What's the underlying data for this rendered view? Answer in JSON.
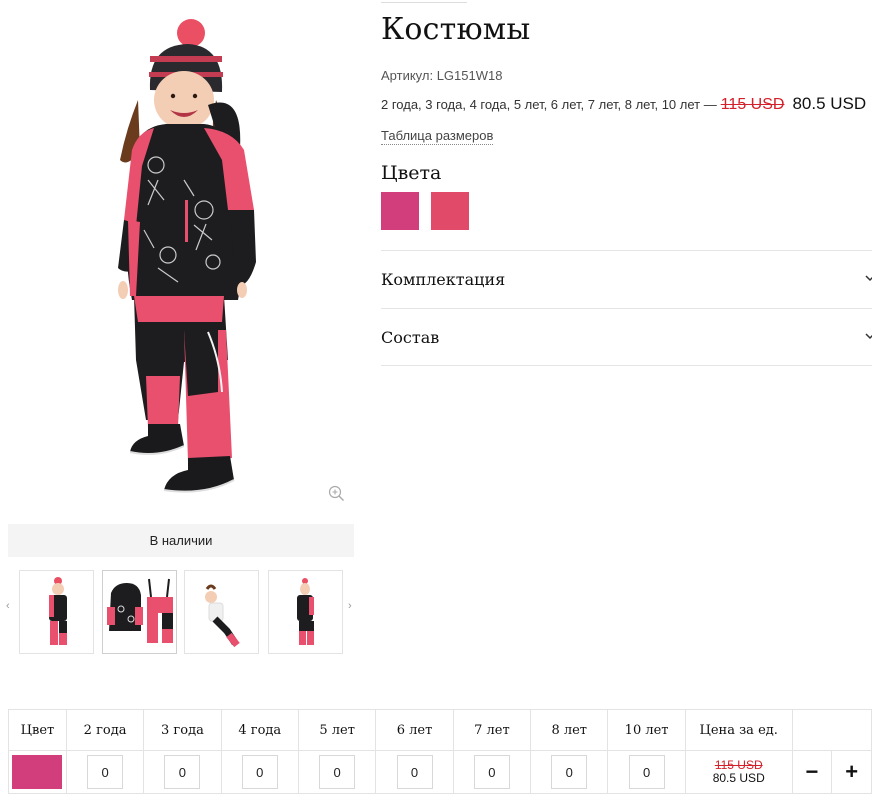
{
  "gallery": {
    "stock_label": "В наличии",
    "prev_arrow": "‹",
    "next_arrow": "›",
    "zoom_icon": "zoom-in-icon"
  },
  "product": {
    "title": "Костюмы",
    "sku": "Артикул: LG151W18",
    "sizes_text": "2 года, 3 года, 4 года, 5 лет, 6 лет, 7 лет, 8 лет, 10 лет —",
    "price_old": "115 USD",
    "price_new": "80.5 USD",
    "size_chart_link": "Таблица размеров",
    "colors_heading": "Цвета",
    "colors": [
      "#d23d7c",
      "#e14a68"
    ]
  },
  "accordions": [
    {
      "label": "Комплектация"
    },
    {
      "label": "Состав"
    }
  ],
  "order_table": {
    "headers": [
      "Цвет",
      "2 года",
      "3 года",
      "4 года",
      "5 лет",
      "6 лет",
      "7 лет",
      "8 лет",
      "10 лет",
      "Цена за ед."
    ],
    "row": {
      "color": "#d23d7c",
      "quantities": [
        "0",
        "0",
        "0",
        "0",
        "0",
        "0",
        "0",
        "0"
      ],
      "price_old": "115 USD",
      "price_new": "80.5 USD",
      "minus": "−",
      "plus": "+"
    }
  },
  "colors": {
    "accent_pink": "#e8506e",
    "strike_red": "#d4202a",
    "jacket_black": "#1d1d1f"
  }
}
